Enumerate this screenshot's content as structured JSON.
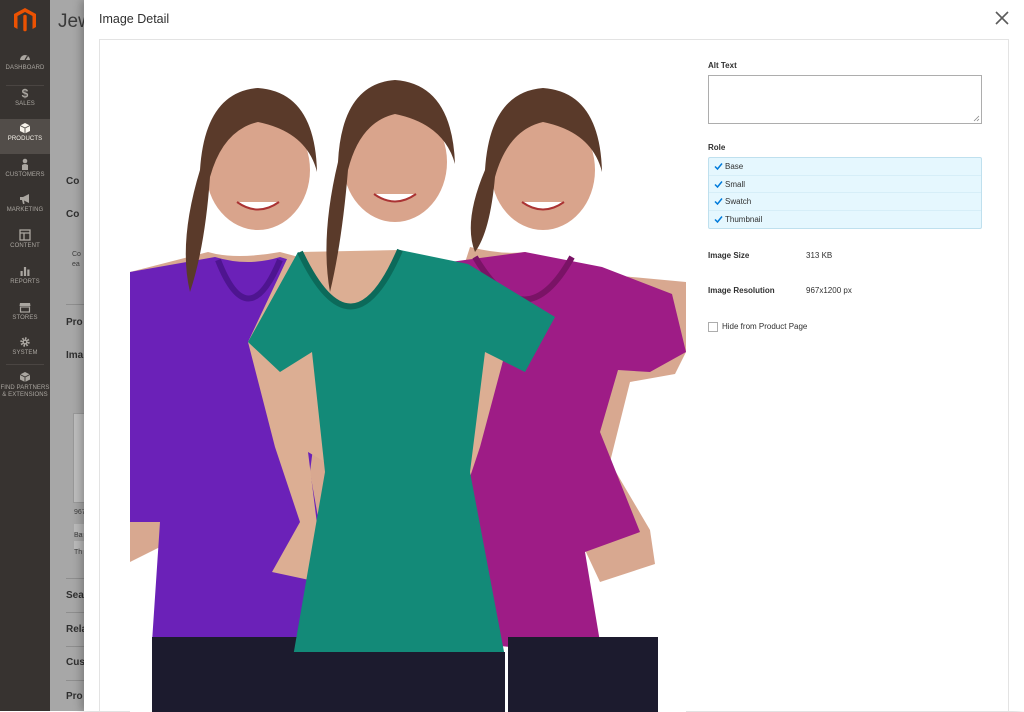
{
  "sidebar": {
    "items": [
      {
        "label": "DASHBOARD",
        "icon": "dashboard-icon"
      },
      {
        "label": "SALES",
        "icon": "dollar-icon"
      },
      {
        "label": "PRODUCTS",
        "icon": "cube-icon"
      },
      {
        "label": "CUSTOMERS",
        "icon": "person-icon"
      },
      {
        "label": "MARKETING",
        "icon": "megaphone-icon"
      },
      {
        "label": "CONTENT",
        "icon": "layout-icon"
      },
      {
        "label": "REPORTS",
        "icon": "bar-chart-icon"
      },
      {
        "label": "STORES",
        "icon": "store-icon"
      },
      {
        "label": "SYSTEM",
        "icon": "gear-icon"
      },
      {
        "label": "FIND PARTNERS",
        "label2": "& EXTENSIONS",
        "icon": "partners-icon"
      }
    ]
  },
  "background": {
    "page_title": "Jew",
    "section_labels": [
      "Co",
      "Co",
      "Pro",
      "Ima",
      "Sea",
      "Rela",
      "Cus",
      "Pro"
    ],
    "small_text": [
      "Co",
      "ea",
      "967",
      "Ba",
      "Th"
    ]
  },
  "modal": {
    "title": "Image Detail",
    "alt_text": {
      "label": "Alt Text",
      "value": ""
    },
    "role": {
      "label": "Role",
      "options": [
        "Base",
        "Small",
        "Swatch",
        "Thumbnail"
      ]
    },
    "image_size": {
      "label": "Image Size",
      "value": "313 KB"
    },
    "image_resolution": {
      "label": "Image Resolution",
      "value": "967x1200 px"
    },
    "hide_from_product_page": {
      "label": "Hide from Product Page",
      "checked": false
    }
  },
  "colors": {
    "sidebar_bg": "#373330",
    "accent_orange": "#eb5202",
    "role_bg": "#e5f7fe",
    "check_blue": "#007bdb"
  }
}
